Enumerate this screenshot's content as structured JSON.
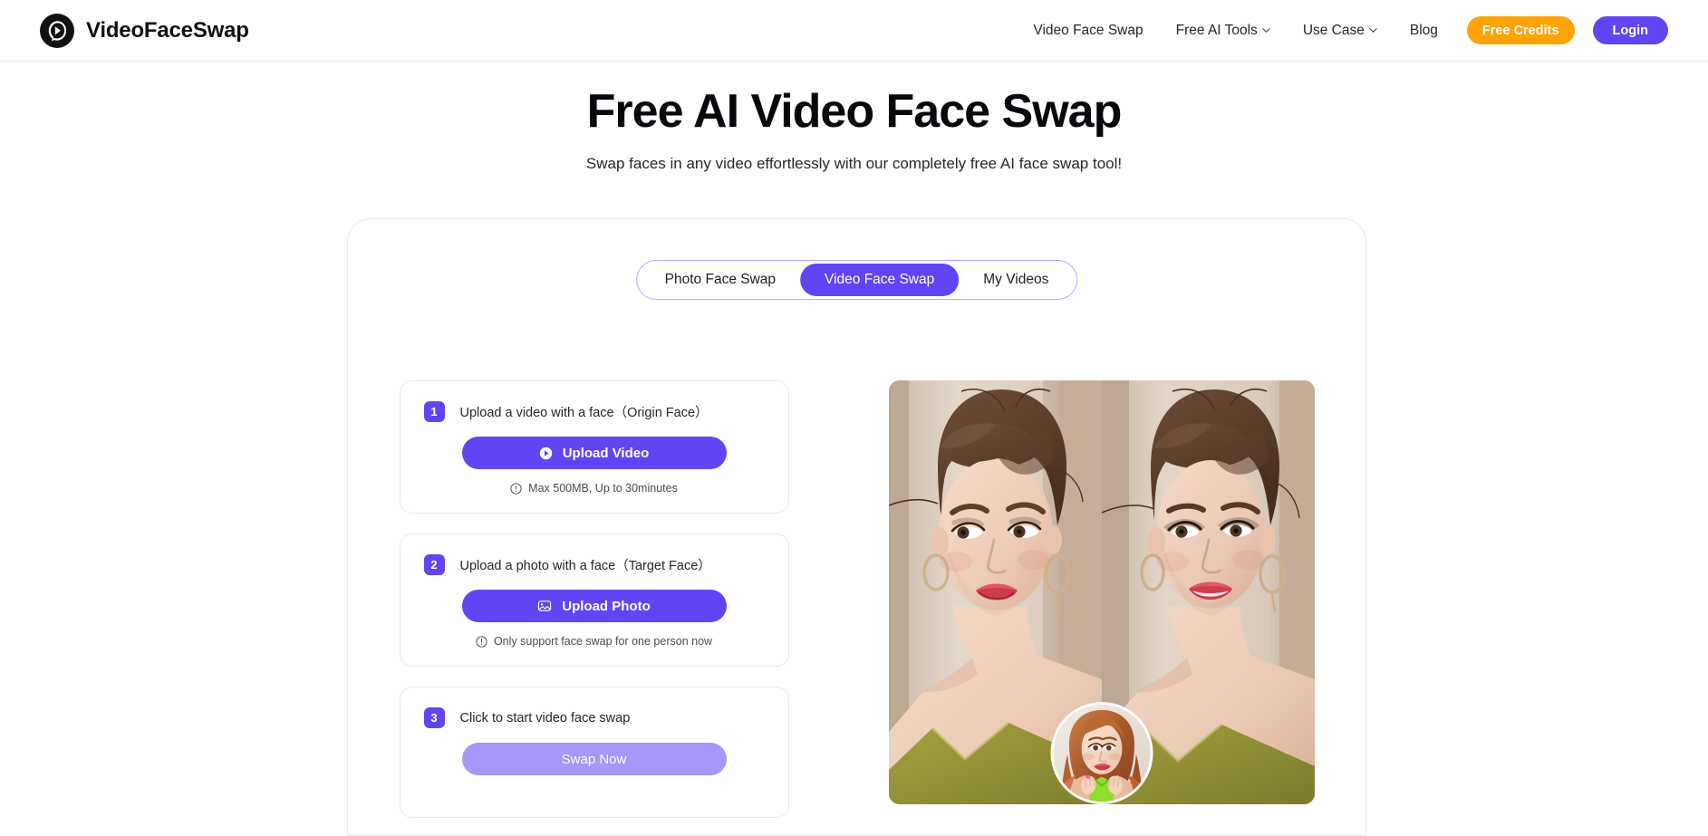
{
  "header": {
    "brand": {
      "name": "VideoFaceSwap",
      "logo_icon": "face-play-logo-icon"
    },
    "nav": [
      {
        "label": "Video Face Swap",
        "has_caret": false
      },
      {
        "label": "Free AI Tools",
        "has_caret": true
      },
      {
        "label": "Use Case",
        "has_caret": true
      },
      {
        "label": "Blog",
        "has_caret": false
      }
    ],
    "credits_label": "Free Credits",
    "login_label": "Login",
    "credits_color": "#ffa408",
    "login_color": "#6344f5"
  },
  "hero": {
    "title": "Free AI Video Face Swap",
    "subtitle": "Swap faces in any video effortlessly with our completely free AI face swap tool!"
  },
  "tabs": {
    "items": [
      {
        "label": "Photo Face Swap",
        "active": false
      },
      {
        "label": "Video Face Swap",
        "active": true
      },
      {
        "label": "My Videos",
        "active": false
      }
    ],
    "active_color": "#6344f5",
    "border_color": "#b9a8fb"
  },
  "steps": [
    {
      "number": "1",
      "title": "Upload a video with a face（Origin Face）",
      "button_label": "Upload Video",
      "button_icon": "play-circle-icon",
      "button_state": "enabled",
      "hint": "Max 500MB, Up to 30minutes",
      "hint_icon": "info-circle-icon"
    },
    {
      "number": "2",
      "title": "Upload a photo with a face（Target Face）",
      "button_label": "Upload Photo",
      "button_icon": "image-icon",
      "button_state": "enabled",
      "hint": "Only support face swap for one person now",
      "hint_icon": "info-circle-icon"
    },
    {
      "number": "3",
      "title": "Click to start video face swap",
      "button_label": "Swap Now",
      "button_icon": "none",
      "button_state": "disabled",
      "hint": "",
      "hint_icon": ""
    }
  ],
  "preview": {
    "name": "face-swap-before-after-preview",
    "description": "Side-by-side before and after portrait of a woman with upswept brown hair, red lipstick and an olive green top",
    "inset_avatar": "target-face-avatar-circle"
  }
}
